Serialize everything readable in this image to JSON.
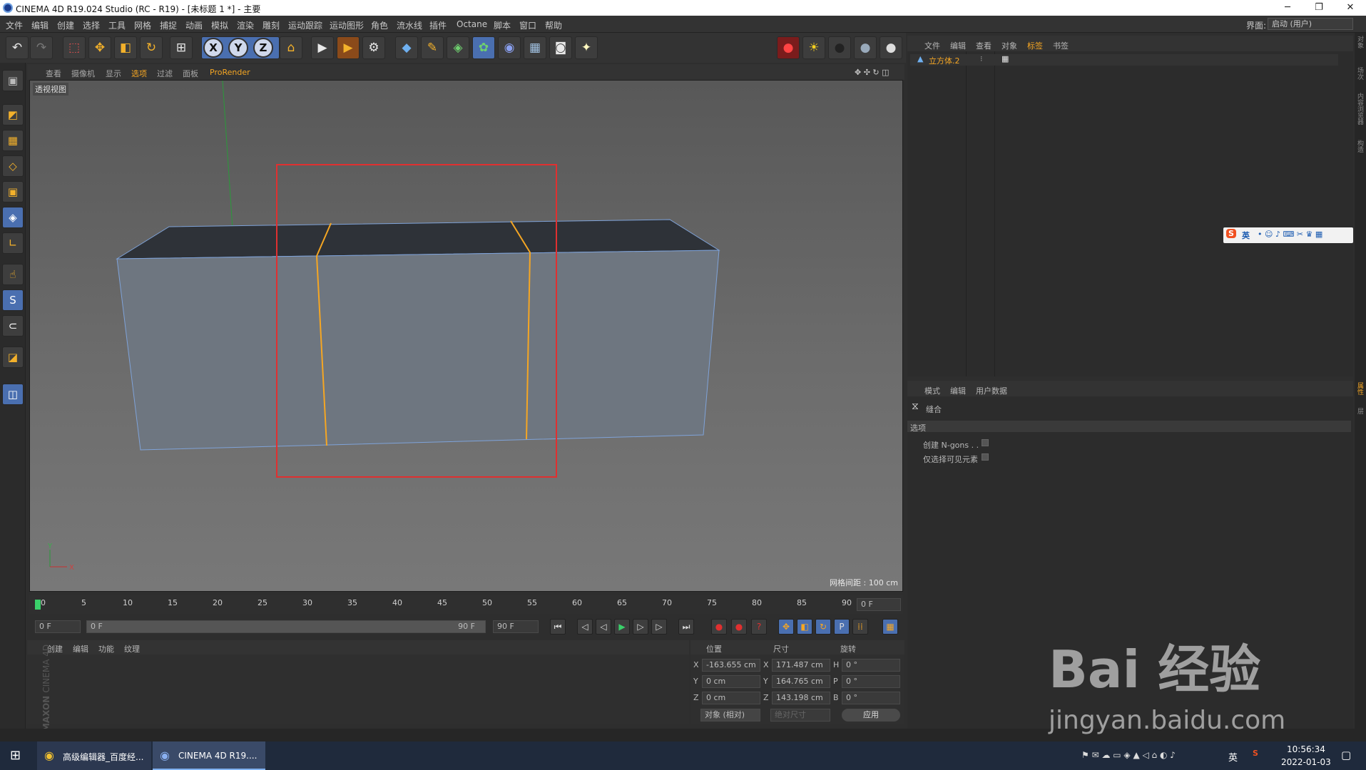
{
  "window": {
    "title": "CINEMA 4D R19.024 Studio (RC - R19) - [未标题 1 *] - 主要",
    "min": "─",
    "max": "❐",
    "close": "✕"
  },
  "menu": [
    "文件",
    "编辑",
    "创建",
    "选择",
    "工具",
    "网格",
    "捕捉",
    "动画",
    "模拟",
    "渲染",
    "雕刻",
    "运动跟踪",
    "运动图形",
    "角色",
    "流水线",
    "插件",
    "Octane",
    "脚本",
    "窗口",
    "帮助"
  ],
  "interface": {
    "label": "界面:",
    "value": "启动 (用户)"
  },
  "toolbar": {
    "undo": "↶",
    "redo": "↷",
    "select": "⬚",
    "move": "✥",
    "scale": "◧",
    "rotate": "↻",
    "coord": "⊞",
    "x": "X",
    "y": "Y",
    "z": "Z",
    "world": "⌂",
    "render_view": "▶",
    "render": "▶",
    "render_settings": "⚙",
    "cube": "◆",
    "pen": "✎",
    "subdiv": "◈",
    "cloner": "✿",
    "deform": "◉",
    "floor": "▦",
    "camera": "◙",
    "light": "✦",
    "rec": "●",
    "sun": "☀",
    "sphere1": "●",
    "sphere2": "●",
    "sphere3": "●"
  },
  "left_tools": [
    "▣",
    "◩",
    "▦",
    "◇",
    "▣",
    "◈",
    "∟",
    "☝",
    "S",
    "⊂",
    "◪",
    "◫"
  ],
  "viewport": {
    "menu": [
      "查看",
      "摄像机",
      "显示",
      "选项",
      "过滤",
      "面板",
      "ProRender"
    ],
    "name": "透视视图",
    "grid": "网格间距 : 100 cm",
    "axis_y": "Y",
    "axis_x": "X"
  },
  "timeline": {
    "ticks": [
      "0",
      "5",
      "10",
      "15",
      "20",
      "25",
      "30",
      "35",
      "40",
      "45",
      "50",
      "55",
      "60",
      "65",
      "70",
      "75",
      "80",
      "85",
      "90"
    ],
    "frame": "0 F"
  },
  "range": {
    "start": "0 F",
    "slider_start": "0 F",
    "slider_end": "90 F",
    "end": "90 F"
  },
  "playback": [
    "⏮",
    "◁",
    "◁",
    "▶",
    "▷",
    "▷",
    "⏭"
  ],
  "keys": [
    "●",
    "●",
    "?",
    "✥",
    "◧",
    "↻",
    "P",
    "⁞⁞",
    "▦"
  ],
  "material": {
    "menu": [
      "创建",
      "编辑",
      "功能",
      "纹理"
    ],
    "brand1": "MAXON",
    "brand2": "CINEMA 4D"
  },
  "coords": {
    "headers": [
      "位置",
      "尺寸",
      "旋转"
    ],
    "rows": [
      {
        "a": "X",
        "v1": "-163.655 cm",
        "b": "X",
        "v2": "171.487 cm",
        "c": "H",
        "v3": "0 °"
      },
      {
        "a": "Y",
        "v1": "0 cm",
        "b": "Y",
        "v2": "164.765 cm",
        "c": "P",
        "v3": "0 °"
      },
      {
        "a": "Z",
        "v1": "0 cm",
        "b": "Z",
        "v2": "143.198 cm",
        "c": "B",
        "v3": "0 °"
      }
    ],
    "mode": "对象 (相对)",
    "size_mode": "绝对尺寸",
    "apply": "应用"
  },
  "objects": {
    "menu": [
      "文件",
      "编辑",
      "查看",
      "对象",
      "标签",
      "书签"
    ],
    "item": "立方体.2"
  },
  "ime": {
    "s": "S",
    "lang": "英"
  },
  "attrs": {
    "menu": [
      "模式",
      "编辑",
      "用户数据"
    ],
    "tool": "缝合",
    "section": "选项",
    "opt1": "创建 N-gons . .",
    "opt2": "仅选择可见元素"
  },
  "right_tabs": [
    "对象",
    "场次",
    "内容浏览器",
    "构造",
    "属性",
    "层"
  ],
  "taskbar": {
    "task1": "高级编辑器_百度经...",
    "task2": "CINEMA 4D R19....",
    "ime": "英",
    "time": "10:56:34",
    "date": "2022-01-03"
  },
  "watermark": {
    "text": "Bai  经验",
    "url": "jingyan.baidu.com"
  },
  "colors": {
    "accent": "#4a6fb0",
    "edge": "#f5a623",
    "highlight": "#e03030"
  }
}
